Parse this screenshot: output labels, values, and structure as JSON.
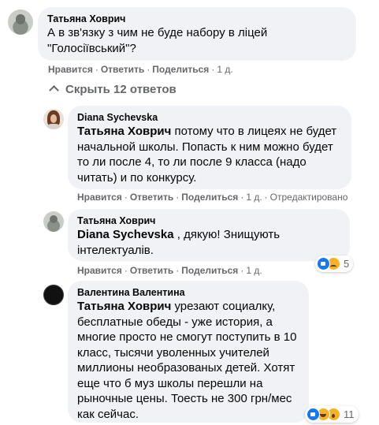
{
  "comments": [
    {
      "author": "Татьяна Ховрич",
      "text": "А в зв'язку з чим не буде набору в ліцей \"Голосіївський\"?",
      "actions": {
        "like": "Нравится",
        "reply": "Ответить",
        "share": "Поделиться",
        "time": "1 д."
      }
    }
  ],
  "toggle_replies": "Скрыть 12 ответов",
  "replies": [
    {
      "author": "Diana Sychevska",
      "mention": "Татьяна Ховрич",
      "text": " потому что в лицеях не будет начальной школы. Попасть к ним можно будет то ли после 4, то ли после 9 класса (надо читать) и по конкурсу.",
      "actions": {
        "like": "Нравится",
        "reply": "Ответить",
        "share": "Поделиться",
        "time": "1 д.",
        "edited": "Отредактировано"
      }
    },
    {
      "author": "Татьяна Ховрич",
      "mention": "Diana Sychevska",
      "text": " , дякую! Знищують інтелектуалів.",
      "actions": {
        "like": "Нравится",
        "reply": "Ответить",
        "share": "Поделиться",
        "time": "1 д."
      },
      "reactions": {
        "icons": [
          "like-icon",
          "sad-icon"
        ],
        "count": "5"
      }
    },
    {
      "author": "Валентина Валентина",
      "mention": "Татьяна Ховрич",
      "text": " урезают социалку, бесплатные обеды - уже история, а многие просто не смогут поступить в 10 класс, тысячи уволенных учителей миллионы необразованых детей. Хотят еще что б муз школы перешли на рыночные цены. Тоесть не 300 грн/мес как сейчас.",
      "reactions": {
        "icons": [
          "like-icon",
          "haha-icon",
          "wow-icon"
        ],
        "count": "11"
      }
    }
  ],
  "separator": "·"
}
